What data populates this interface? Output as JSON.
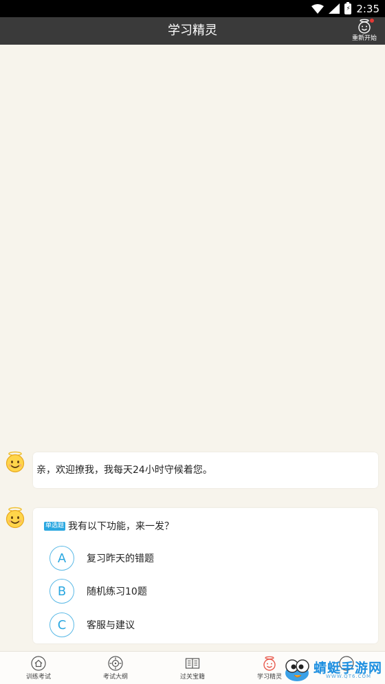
{
  "status_bar": {
    "time": "2:35",
    "battery_glyph": "⚡"
  },
  "title_bar": {
    "title": "学习精灵",
    "restart_label": "重新开始"
  },
  "chat": {
    "messages": [
      {
        "text": "亲，欢迎撩我，我每天24小时守候着您。"
      },
      {
        "tag": "单选题",
        "question": "我有以下功能，来一发？",
        "options": [
          {
            "letter": "A",
            "text": "复习昨天的错题"
          },
          {
            "letter": "B",
            "text": "随机练习10题"
          },
          {
            "letter": "C",
            "text": "客服与建议"
          }
        ]
      }
    ]
  },
  "bottom_nav": {
    "items": [
      {
        "label": "训练考试",
        "icon": "home-icon"
      },
      {
        "label": "考试大纲",
        "icon": "compass-icon"
      },
      {
        "label": "过关宝籍",
        "icon": "book-icon"
      },
      {
        "label": "学习精灵",
        "icon": "smiley-icon"
      }
    ]
  },
  "watermark": {
    "text": "蜻蜓手游网",
    "url": "WWW.QT6.COM"
  },
  "colors": {
    "accent": "#2aa7e0",
    "title_bar": "#3a3a3a",
    "background": "#f7f4ec",
    "badge": "#e53935"
  }
}
